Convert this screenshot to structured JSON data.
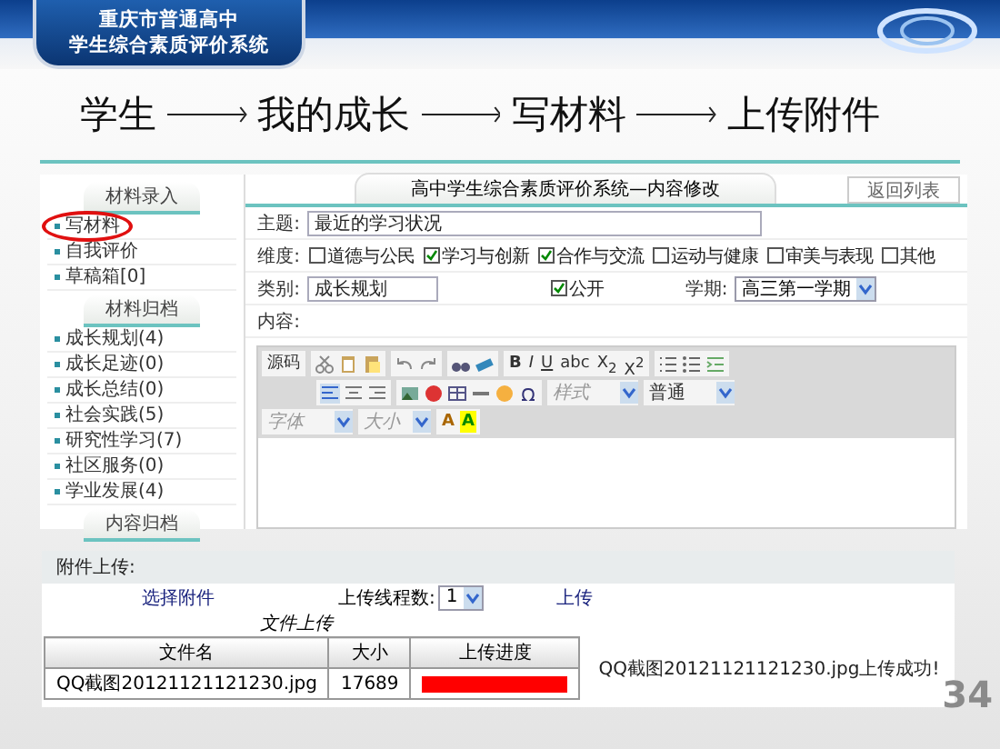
{
  "banner": {
    "title_lines": [
      "重庆市普通高中",
      "学生综合素质评价系统"
    ]
  },
  "flow": {
    "steps": [
      "学生",
      "我的成长",
      "写材料",
      "上传附件"
    ]
  },
  "sidebar": {
    "sections": [
      {
        "title": "材料录入",
        "items": [
          {
            "label": "写材料",
            "selected": true
          },
          {
            "label": "自我评价",
            "selected": false
          },
          {
            "label": "草稿箱[0]",
            "selected": false
          }
        ]
      },
      {
        "title": "材料归档",
        "items": [
          {
            "label": "成长规划(4)",
            "selected": false
          },
          {
            "label": "成长足迹(0)",
            "selected": false
          },
          {
            "label": "成长总结(0)",
            "selected": false
          },
          {
            "label": "社会实践(5)",
            "selected": false
          },
          {
            "label": "研究性学习(7)",
            "selected": false
          },
          {
            "label": "社区服务(0)",
            "selected": false
          },
          {
            "label": "学业发展(4)",
            "selected": false
          }
        ]
      },
      {
        "title": "内容归档"
      }
    ]
  },
  "form": {
    "tab_title": "高中学生综合素质评价系统—内容修改",
    "back_button": "返回列表",
    "subject": {
      "label": "主题:",
      "value": "最近的学习状况"
    },
    "dimensions": {
      "label": "维度:",
      "options": [
        {
          "label": "道德与公民",
          "checked": false
        },
        {
          "label": "学习与创新",
          "checked": true
        },
        {
          "label": "合作与交流",
          "checked": true
        },
        {
          "label": "运动与健康",
          "checked": false
        },
        {
          "label": "审美与表现",
          "checked": false
        },
        {
          "label": "其他",
          "checked": false
        }
      ]
    },
    "category": {
      "label": "类别:",
      "value": "成长规划"
    },
    "public": {
      "label": "公开",
      "checked": true
    },
    "term": {
      "label": "学期:",
      "value": "高三第一学期"
    },
    "content": {
      "label": "内容:"
    },
    "editor": {
      "source_button": "源码",
      "format_buttons": [
        "B",
        "I",
        "U",
        "abc",
        "X$_{2}$",
        "X$^{2}$"
      ],
      "style_select": {
        "placeholder": "样式"
      },
      "paragraph_select": {
        "value": "普通"
      },
      "font_select": {
        "placeholder": "字体"
      },
      "size_select": {
        "placeholder": "大小"
      },
      "color_buttons": [
        "A",
        "A"
      ]
    }
  },
  "upload": {
    "title": "附件上传:",
    "choose_link": "选择附件",
    "threads": {
      "label": "上传线程数:",
      "value": "1"
    },
    "upload_link": "上传",
    "caption": "文件上传",
    "table": {
      "columns": [
        "文件名",
        "大小",
        "上传进度"
      ],
      "rows": [
        {
          "name": "QQ截图20121121121230.jpg",
          "size": "17689",
          "level": 1
        }
      ]
    },
    "message": "QQ截图20121121121230.jpg上传成功!"
  },
  "page_number": "34"
}
